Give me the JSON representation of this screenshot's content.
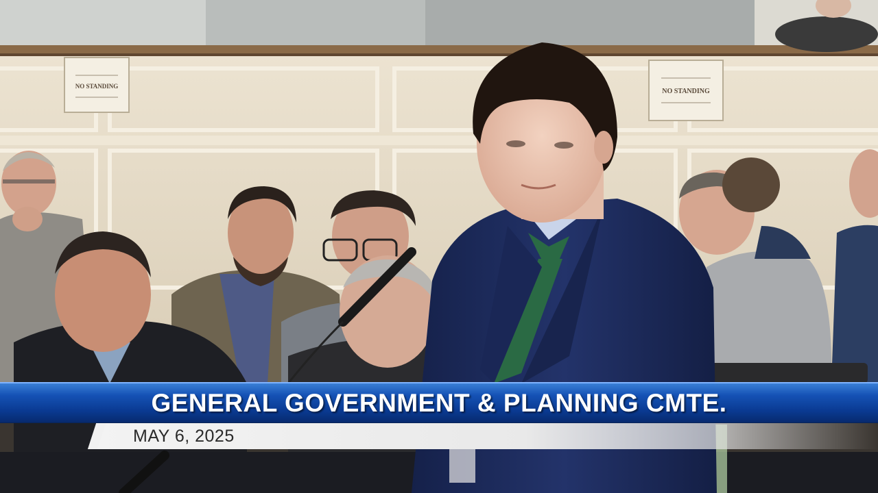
{
  "lower_third": {
    "title": "GENERAL GOVERNMENT & PLANNING CMTE.",
    "date": "MAY 6, 2025"
  },
  "wall_signs": {
    "left": "NO STANDING",
    "right": "NO STANDING"
  },
  "colors": {
    "banner_blue": "#0a3a92",
    "banner_highlight": "#3a7fd6",
    "date_bar": "#eeeeee",
    "wall": "#e6dcc8",
    "suit_navy": "#1c2a5a",
    "tie_green": "#2a6a44"
  }
}
